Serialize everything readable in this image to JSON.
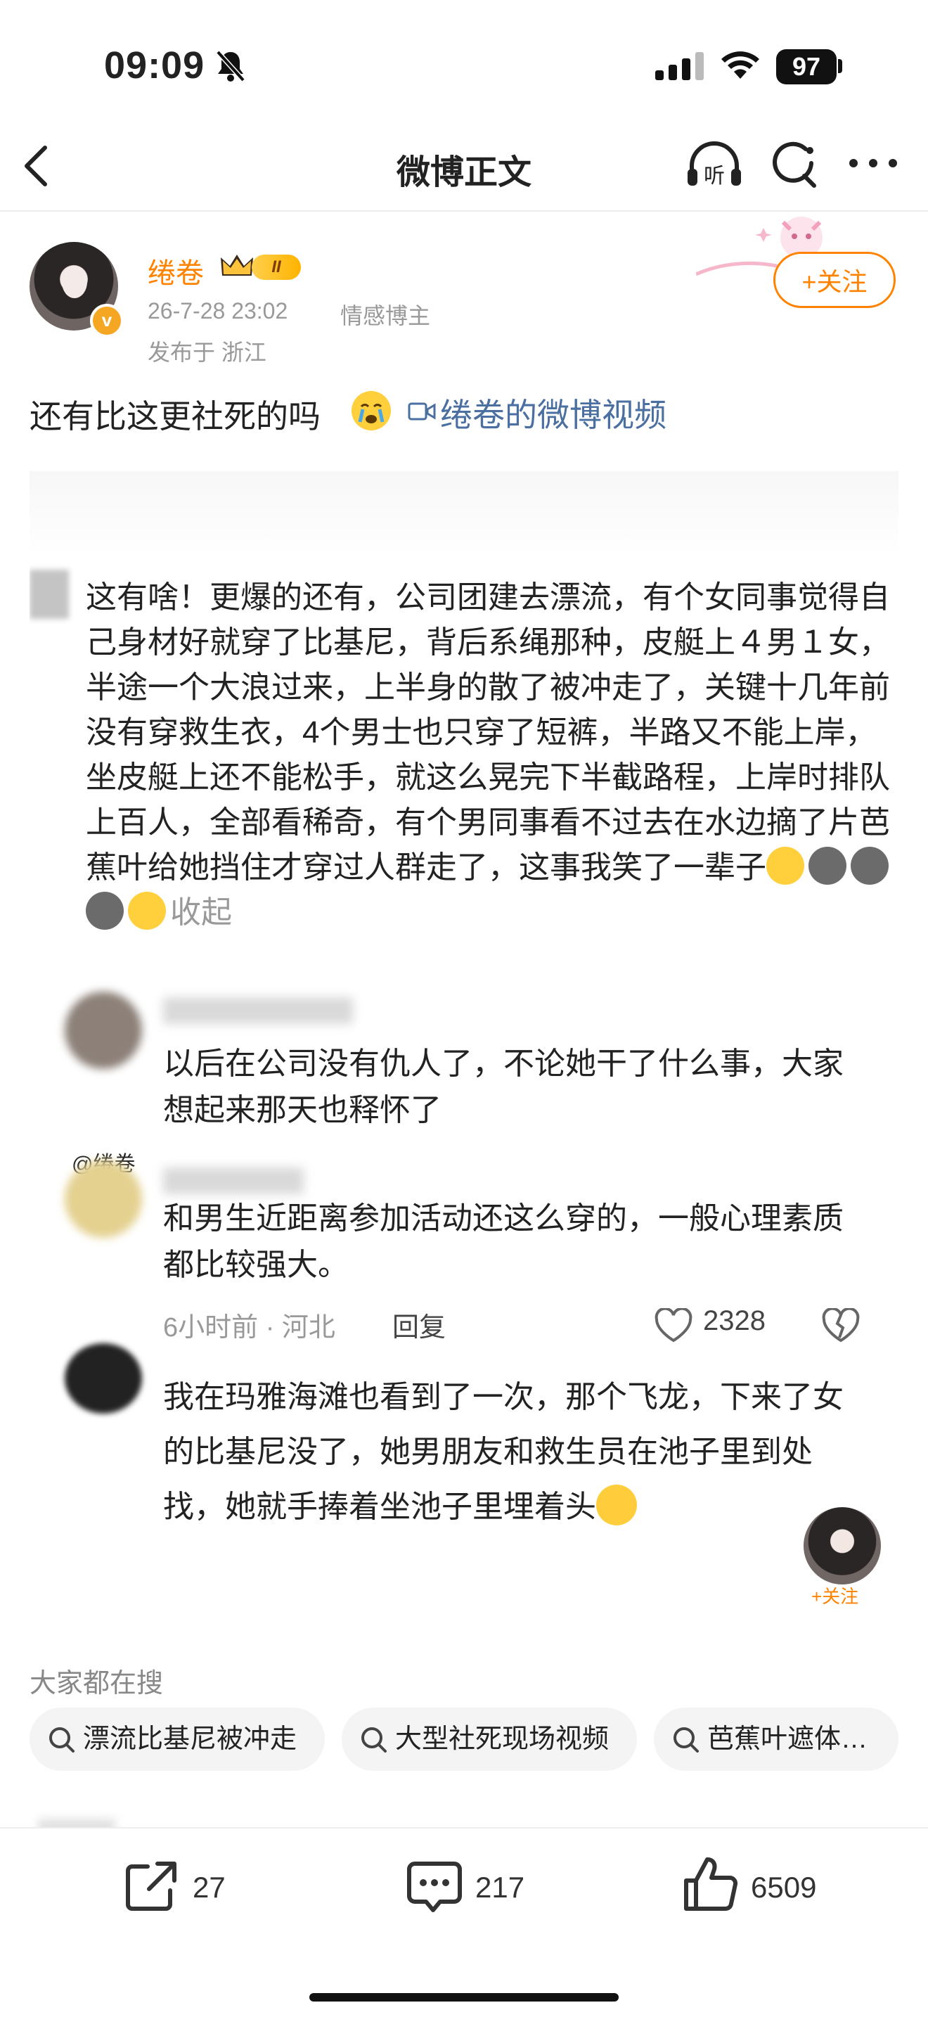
{
  "status_bar": {
    "time": "09:09",
    "battery": "97"
  },
  "nav": {
    "title": "微博正文",
    "listen_label": "听"
  },
  "author": {
    "name": "绻卷",
    "level": "II",
    "verified_mark": "v",
    "time": "26-7-28 23:02",
    "role": "情感博主",
    "location": "发布于 浙江",
    "follow_label": "+关注"
  },
  "post": {
    "text": "还有比这更社死的吗",
    "video_link": "绻卷的微博视频"
  },
  "screenshot": {
    "main_comment": "这有啥！更爆的还有，公司团建去漂流，有个女同事觉得自己身材好就穿了比基尼，背后系绳那种，皮艇上４男１女，半途一个大浪过来，上半身的散了被冲走了，关键十几年前没有穿救生衣，4个男士也只穿了短裤，半路又不能上岸，坐皮艇上还不能松手，就这么晃完下半截路程，上岸时排队上百人，全部看稀奇，有个男同事看不过去在水边摘了片芭蕉叶给她挡住才穿过人群走了，这事我笑了一辈子",
    "collapse_label": "收起",
    "reply_1": "以后在公司没有仇人了，不论她干了什么事，大家想起来那天也释怀了",
    "mention": "@绻卷",
    "reply_2": "和男生近距离参加活动还这么穿的，一般心理素质都比较强大。",
    "reply_2_time": "6小时前 · 河北",
    "reply_label": "回复",
    "reply_2_likes": "2328",
    "reply_3": "我在玛雅海滩也看到了一次，那个飞龙，下来了女的比基尼没了，她男朋友和救生员在池子里到处找，她就手捧着坐池子里埋着头",
    "float_follow": "+关注"
  },
  "search": {
    "heading": "大家都在搜",
    "chips": [
      "漂流比基尼被冲走",
      "大型社死现场视频",
      "芭蕉叶遮体…"
    ]
  },
  "bottom_bar": {
    "shares": "27",
    "comments": "217",
    "likes": "6509"
  },
  "colors": {
    "accent": "#ff8200",
    "link": "#4a6fa0"
  }
}
